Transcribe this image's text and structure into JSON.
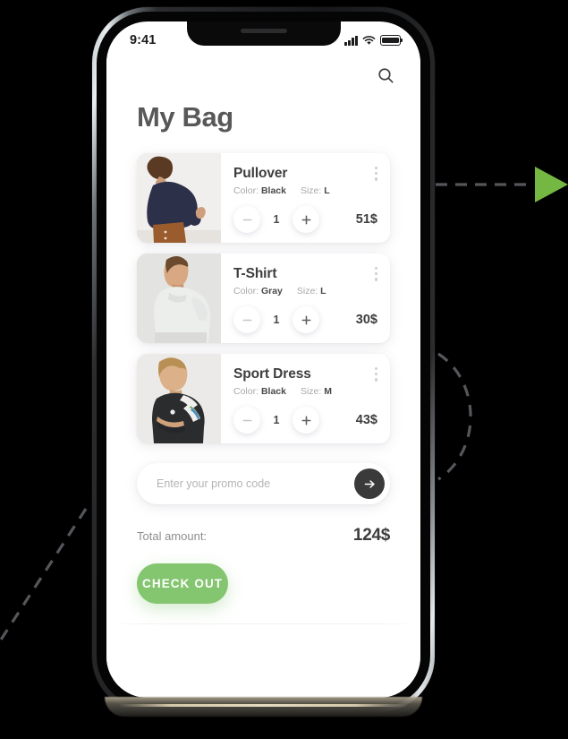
{
  "status_bar": {
    "time": "9:41",
    "signal_icon": "signal-bars-icon",
    "wifi_icon": "wifi-icon",
    "battery_icon": "battery-icon"
  },
  "header": {
    "title": "My Bag",
    "search_icon": "search-icon"
  },
  "cart": {
    "items": [
      {
        "name": "Pullover",
        "color_label": "Color:",
        "color_value": "Black",
        "size_label": "Size:",
        "size_value": "L",
        "quantity": "1",
        "price": "51$",
        "menu_icon": "more-vertical-icon",
        "decrease_icon": "minus-icon",
        "increase_icon": "plus-icon",
        "thumbnail": "woman-navy-pullover-photo"
      },
      {
        "name": "T-Shirt",
        "color_label": "Color:",
        "color_value": "Gray",
        "size_label": "Size:",
        "size_value": "L",
        "quantity": "1",
        "price": "30$",
        "menu_icon": "more-vertical-icon",
        "decrease_icon": "minus-icon",
        "increase_icon": "plus-icon",
        "thumbnail": "man-gray-tshirt-photo"
      },
      {
        "name": "Sport Dress",
        "color_label": "Color:",
        "color_value": "Black",
        "size_label": "Size:",
        "size_value": "M",
        "quantity": "1",
        "price": "43$",
        "menu_icon": "more-vertical-icon",
        "decrease_icon": "minus-icon",
        "increase_icon": "plus-icon",
        "thumbnail": "woman-black-sport-dress-photo"
      }
    ]
  },
  "promo": {
    "placeholder": "Enter your promo code",
    "value": "",
    "submit_icon": "arrow-right-icon"
  },
  "summary": {
    "total_label": "Total amount:",
    "total_value": "124$"
  },
  "checkout": {
    "label": "CHECK OUT"
  },
  "annotations": {
    "arrow_icon": "green-triangle-arrow",
    "arrow_color": "#74b843",
    "guide_color": "#55565a"
  },
  "theme": {
    "accent_green": "#84c56f",
    "dark_button": "#3a3a3a",
    "title_gray": "#585858",
    "background": "#000000",
    "screen_background": "#ffffff"
  }
}
